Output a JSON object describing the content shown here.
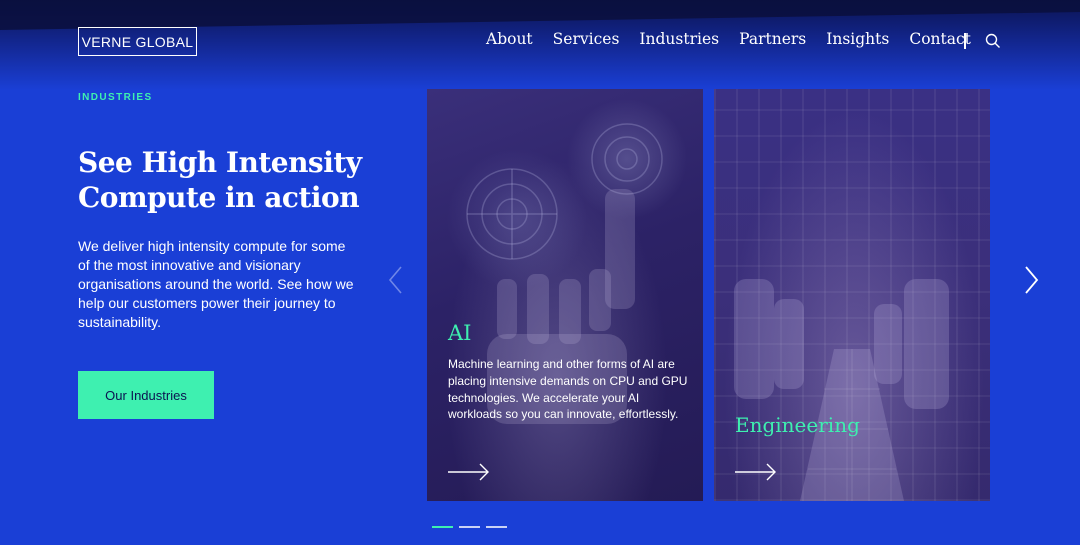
{
  "header": {
    "logo_text": "VERNE GLOBAL",
    "nav": [
      {
        "label": "About"
      },
      {
        "label": "Services"
      },
      {
        "label": "Industries"
      },
      {
        "label": "Partners"
      },
      {
        "label": "Insights"
      },
      {
        "label": "Contact"
      }
    ],
    "search_icon": "search-icon"
  },
  "hero": {
    "eyebrow": "INDUSTRIES",
    "headline": "See High Intensity Compute in action",
    "lead": "We deliver high intensity compute for some of the most innovative and visionary organisations around the world. See how we help our customers power their journey to sustainability.",
    "cta_label": "Our Industries"
  },
  "carousel": {
    "prev_icon": "chevron-left-icon",
    "next_icon": "chevron-right-icon",
    "cards": [
      {
        "title": "AI",
        "text": "Machine learning and other forms of AI are placing intensive demands on CPU and GPU technologies. We accelerate your AI workloads so you can innovate, effortlessly.",
        "arrow_icon": "arrow-right-icon"
      },
      {
        "title": "Engineering",
        "arrow_icon": "arrow-right-icon"
      }
    ],
    "pagination": {
      "total": 3,
      "active": 1
    }
  },
  "colors": {
    "background": "#1a3fd6",
    "accent": "#3ef0b0",
    "card_overlay": "#2c2266"
  }
}
